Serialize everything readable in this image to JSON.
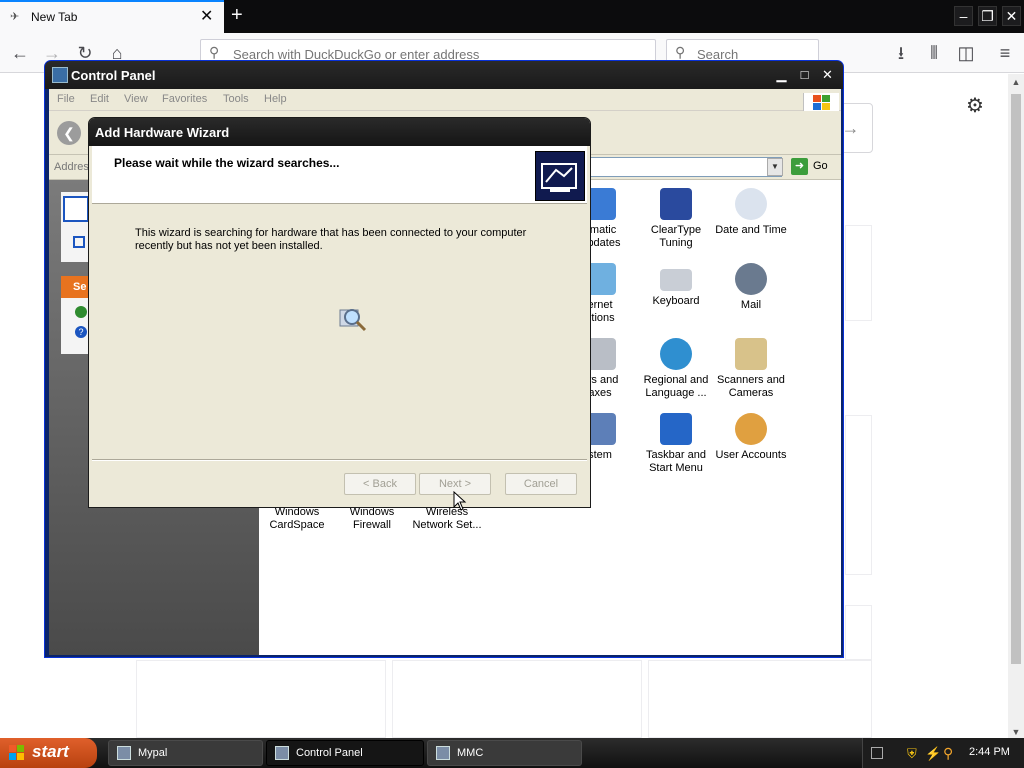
{
  "browser": {
    "tab_title": "New Tab",
    "new_tab_symbol": "+",
    "tab_close": "✕",
    "url_placeholder": "Search with DuckDuckGo or enter address",
    "search_placeholder": "Search",
    "window_controls": {
      "minimize": "–",
      "restore": "❐",
      "close": "✕"
    }
  },
  "control_panel": {
    "title": "Control Panel",
    "menu": [
      "File",
      "Edit",
      "View",
      "Favorites",
      "Tools",
      "Help"
    ],
    "address_label": "Addres",
    "go_label": "Go",
    "taskpane_header": "Se",
    "items": [
      {
        "label": "omatic\nUpdates"
      },
      {
        "label": "ClearType\nTuning"
      },
      {
        "label": "Date and Time"
      },
      {
        "label": "ernet\nptions"
      },
      {
        "label": "Keyboard"
      },
      {
        "label": "Mail"
      },
      {
        "label": "ers and\naxes"
      },
      {
        "label": "Regional and\nLanguage ..."
      },
      {
        "label": "Scanners and\nCameras"
      },
      {
        "label": "stem"
      },
      {
        "label": "Taskbar and\nStart Menu"
      },
      {
        "label": "User Accounts"
      },
      {
        "label": "Windows\nCardSpace"
      },
      {
        "label": "Windows\nFirewall"
      },
      {
        "label": "Wireless\nNetwork Set..."
      }
    ]
  },
  "wizard": {
    "title": "Add Hardware Wizard",
    "header": "Please wait while the wizard searches...",
    "message": "This wizard is searching for hardware that has been connected to your computer recently but has not yet been installed.",
    "back_label": "< Back",
    "next_label": "Next >",
    "cancel_label": "Cancel"
  },
  "taskbar": {
    "start_label": "start",
    "buttons": [
      "Mypal",
      "Control Panel",
      "MMC"
    ],
    "active_button": "Control Panel",
    "clock": "2:44 PM"
  }
}
